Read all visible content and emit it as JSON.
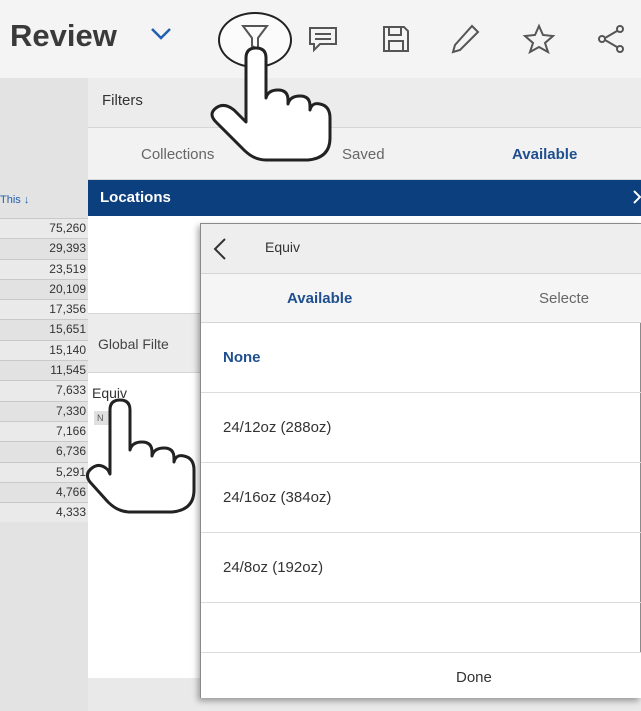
{
  "header": {
    "title": "Review",
    "icons": [
      "chevron-down-icon",
      "filter-icon",
      "comment-icon",
      "save-icon",
      "pencil-icon",
      "star-icon",
      "share-icon"
    ]
  },
  "table": {
    "column_header": "This ↓",
    "values": [
      "75,260",
      "29,393",
      "23,519",
      "20,109",
      "17,356",
      "15,651",
      "15,140",
      "11,545",
      "7,633",
      "7,330",
      "7,166",
      "6,736",
      "5,291",
      "4,766",
      "4,333"
    ]
  },
  "filters": {
    "title": "Filters",
    "tabs": {
      "collections": "Collections",
      "saved": "Saved",
      "available": "Available"
    },
    "locations": "Locations",
    "global": "Global Filte",
    "equiv_label": "Equiv",
    "equiv_chip": "N"
  },
  "popup": {
    "title": "Equiv",
    "tab_available": "Available",
    "tab_selected": "Selecte",
    "options": [
      "None",
      "24/12oz (288oz)",
      "24/16oz (384oz)",
      "24/8oz (192oz)"
    ],
    "done": "Done"
  },
  "colors": {
    "accent": "#0c3f7e",
    "link_blue": "#1f4f8f"
  }
}
